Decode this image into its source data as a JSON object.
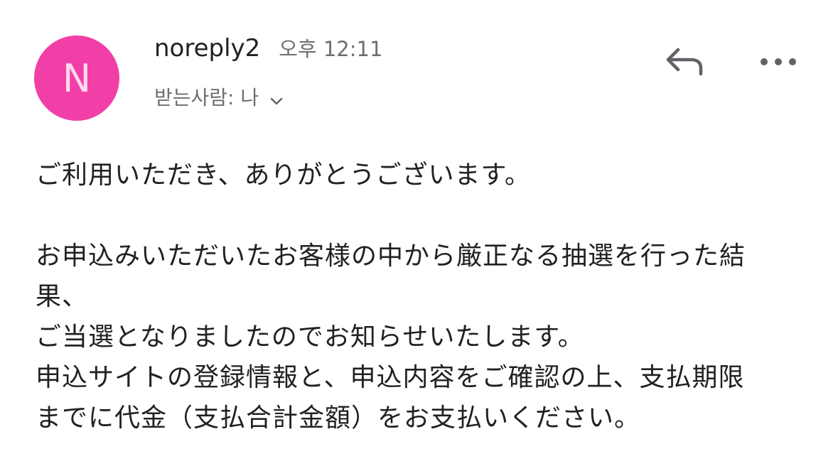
{
  "colors": {
    "avatar_bg": "#f23fa7",
    "avatar_letter": "#ffd6ee",
    "icon_gray": "#5f6368",
    "secondary_text": "#6b6f73"
  },
  "header": {
    "avatar_letter": "N",
    "sender": "noreply2",
    "time": "오후 12:11",
    "recipient": "받는사람: 나",
    "icons": [
      "reply-icon",
      "more-icon",
      "chevron-down-icon"
    ]
  },
  "body": {
    "lines": [
      "ご利用いただき、ありがとうございます。",
      "",
      "お申込みいただいたお客様の中から厳正なる抽選を行った結",
      "果、",
      "ご当選となりましたのでお知らせいたします。",
      "申込サイトの登録情報と、申込内容をご確認の上、支払期限",
      "までに代金（支払合計金額）をお支払いください。"
    ]
  }
}
